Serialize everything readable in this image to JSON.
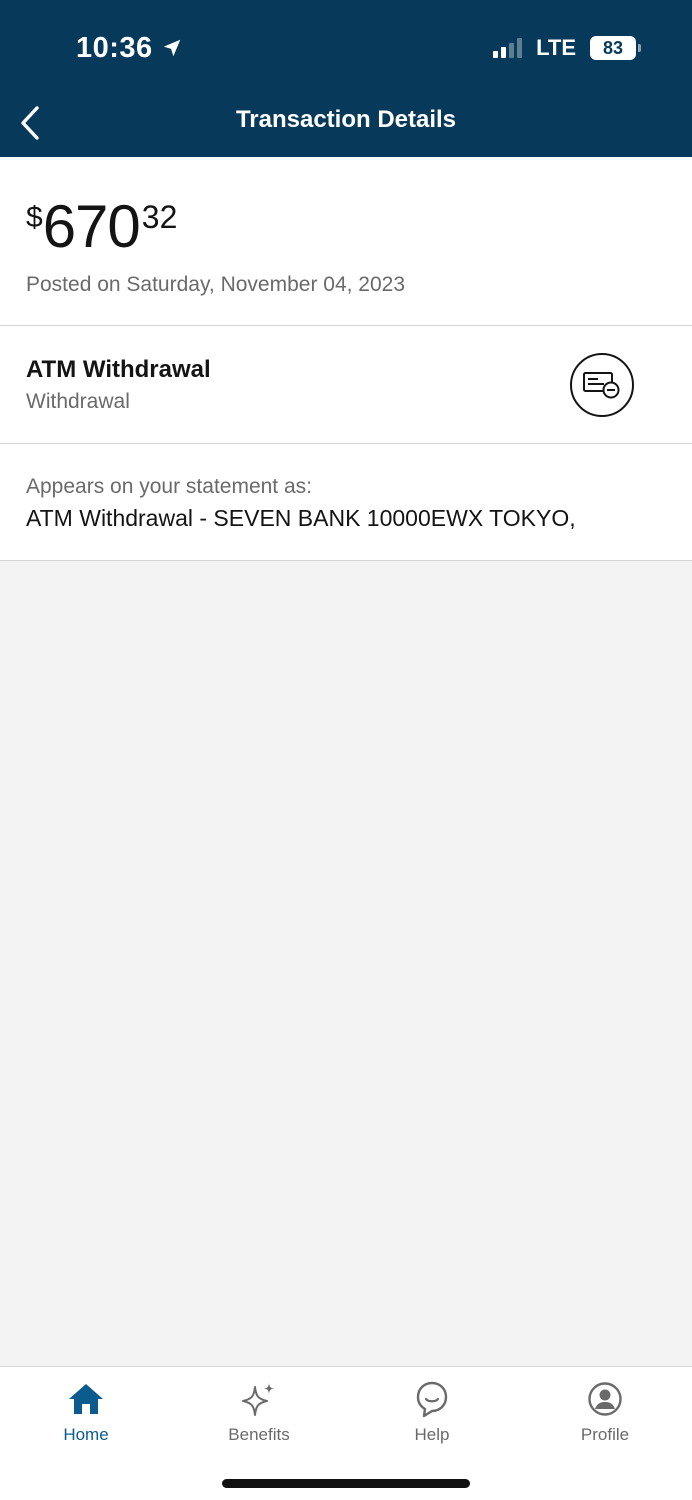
{
  "status_bar": {
    "time": "10:36",
    "network": "LTE",
    "battery": "83"
  },
  "nav": {
    "title": "Transaction Details"
  },
  "amount": {
    "currency_symbol": "$",
    "whole": "670",
    "cents": "32",
    "posted": "Posted on Saturday, November 04, 2023"
  },
  "transaction": {
    "title": "ATM Withdrawal",
    "subtitle": "Withdrawal",
    "icon": "check-withdrawal-icon"
  },
  "statement": {
    "label": "Appears on your statement as:",
    "value": "ATM Withdrawal - SEVEN BANK 10000EWX TOKYO,"
  },
  "tabbar": {
    "items": [
      {
        "label": "Home",
        "icon": "home-icon",
        "active": true
      },
      {
        "label": "Benefits",
        "icon": "sparkle-icon",
        "active": false
      },
      {
        "label": "Help",
        "icon": "chat-bubble-icon",
        "active": false
      },
      {
        "label": "Profile",
        "icon": "profile-icon",
        "active": false
      }
    ]
  },
  "colors": {
    "header_bg": "#073a5a",
    "accent": "#0b5b8f",
    "page_bg": "#f3f3f3"
  }
}
